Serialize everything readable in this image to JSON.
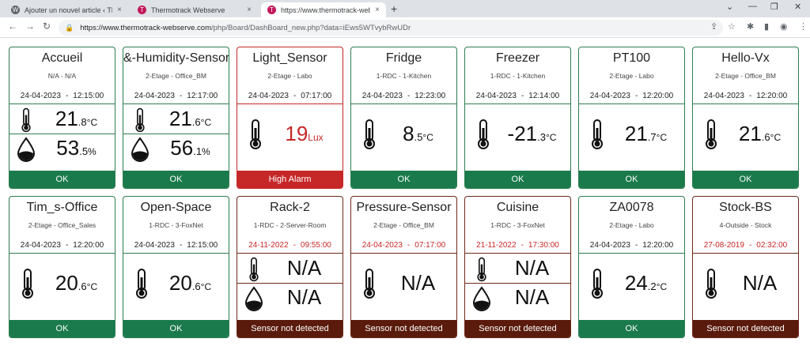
{
  "browser": {
    "tabs": [
      {
        "title": "Ajouter un nouvel article ‹ Thermotrack",
        "close": "×"
      },
      {
        "title": "Thermotrack Webserve",
        "close": "×"
      },
      {
        "title": "https://www.thermotrack-webserve",
        "close": "×"
      }
    ],
    "new_tab": "+",
    "url_domain": "https://www.thermotrack-webserve.com",
    "url_path": "/php/Board/DashBoard_new.php?data=iEws5WTvybRwUDr",
    "icons": [
      "back-icon",
      "forward-icon",
      "reload-icon",
      "lock-icon",
      "share-icon",
      "star-icon",
      "extensions-icon",
      "sidepanel-icon",
      "profile-icon",
      "menu-icon"
    ]
  },
  "colors": {
    "ok": "#1a7a4c",
    "alarm": "#c62828",
    "not_detected": "#5a1a0c"
  },
  "sensors": [
    {
      "name": "Accueil",
      "location": "N/A - N/A",
      "date": "24-04-2023",
      "time": "12:15:00",
      "temp_main": "21",
      "temp_dec": ".8",
      "temp_unit": "°C",
      "hum_main": "53",
      "hum_dec": ".5",
      "hum_unit": "%",
      "status": "OK"
    },
    {
      "name": "&-Humidity-Sensor",
      "location": "2-Etage - Office_BM",
      "date": "24-04-2023",
      "time": "12:17:00",
      "temp_main": "21",
      "temp_dec": ".6",
      "temp_unit": "°C",
      "hum_main": "56",
      "hum_dec": ".1",
      "hum_unit": "%",
      "status": "OK"
    },
    {
      "name": "Light_Sensor",
      "location": "2-Etage - Labo",
      "date": "24-04-2023",
      "time": "07:17:00",
      "val_main": "19",
      "val_dec": "",
      "val_unit": "Lux",
      "status": "High Alarm"
    },
    {
      "name": "Fridge",
      "location": "1-RDC - 1-Kitchen",
      "date": "24-04-2023",
      "time": "12:23:00",
      "val_main": "8",
      "val_dec": ".5",
      "val_unit": "°C",
      "status": "OK"
    },
    {
      "name": "Freezer",
      "location": "1-RDC - 1-Kitchen",
      "date": "24-04-2023",
      "time": "12:14:00",
      "val_main": "-21",
      "val_dec": ".3",
      "val_unit": "°C",
      "status": "OK"
    },
    {
      "name": "PT100",
      "location": "2-Etage - Labo",
      "date": "24-04-2023",
      "time": "12:20:00",
      "val_main": "21",
      "val_dec": ".7",
      "val_unit": "°C",
      "status": "OK"
    },
    {
      "name": "Hello-Vx",
      "location": "2-Etage - Office_BM",
      "date": "24-04-2023",
      "time": "12:20:00",
      "val_main": "21",
      "val_dec": ".6",
      "val_unit": "°C",
      "status": "OK"
    },
    {
      "name": "Tim_s-Office",
      "location": "2-Etage - Office_Sales",
      "date": "24-04-2023",
      "time": "12:20:00",
      "val_main": "20",
      "val_dec": ".6",
      "val_unit": "°C",
      "status": "OK"
    },
    {
      "name": "Open-Space",
      "location": "1-RDC - 3-FoxNet",
      "date": "24-04-2023",
      "time": "12:15:00",
      "val_main": "20",
      "val_dec": ".6",
      "val_unit": "°C",
      "status": "OK"
    },
    {
      "name": "Rack-2",
      "location": "1-RDC - 2-Server-Room",
      "date": "24-11-2022",
      "time": "09:55:00",
      "temp_main": "N/A",
      "hum_main": "N/A",
      "status": "Sensor not detected"
    },
    {
      "name": "Pressure-Sensor",
      "location": "2-Etage - Office_BM",
      "date": "24-04-2023",
      "time": "07:17:00",
      "val_main": "N/A",
      "status": "Sensor not detected"
    },
    {
      "name": "Cuisine",
      "location": "1-RDC - 3-FoxNet",
      "date": "21-11-2022",
      "time": "17:30:00",
      "temp_main": "N/A",
      "hum_main": "N/A",
      "status": "Sensor not detected"
    },
    {
      "name": "ZA0078",
      "location": "2-Etage - Labo",
      "date": "24-04-2023",
      "time": "12:20:00",
      "val_main": "24",
      "val_dec": ".2",
      "val_unit": "°C",
      "status": "OK"
    },
    {
      "name": "Stock-BS",
      "location": "4-Outside - Stock",
      "date": "27-08-2019",
      "time": "02:32:00",
      "val_main": "N/A",
      "status": "Sensor not detected"
    }
  ],
  "dash": "-"
}
